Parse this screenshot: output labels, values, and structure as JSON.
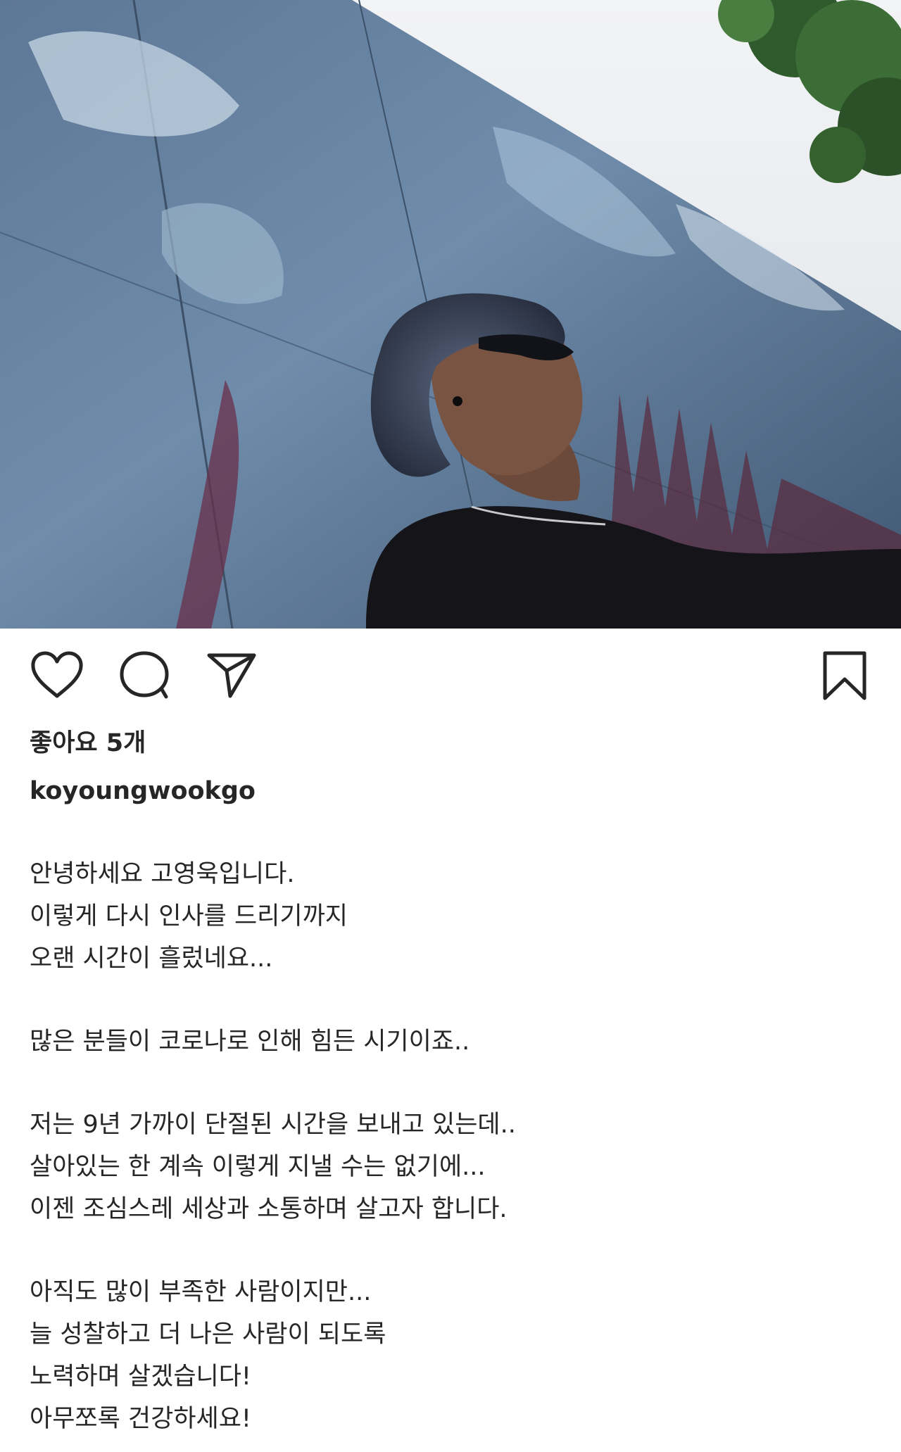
{
  "post": {
    "likes_text": "좋아요 5개",
    "username": "koyoungwookgo",
    "caption": {
      "paragraphs": [
        [
          "안녕하세요 고영욱입니다.",
          "이렇게 다시 인사를 드리기까지",
          "오랜 시간이 흘렀네요..."
        ],
        [
          "많은 분들이 코로나로 인해 힘든 시기이죠.."
        ],
        [
          "저는 9년 가까이 단절된 시간을 보내고 있는데..",
          "살아있는 한 계속 이렇게 지낼 수는 없기에...",
          "이젠 조심스레 세상과 소통하며 살고자 합니다."
        ],
        [
          "아직도 많이 부족한 사람이지만...",
          "늘 성찰하고 더 나은 사람이 되도록",
          "노력하며 살겠습니다!",
          "아무쪼록 건강하세요!"
        ]
      ]
    }
  },
  "actions": {
    "like_icon": "heart-icon",
    "comment_icon": "comment-icon",
    "share_icon": "paper-plane-icon",
    "save_icon": "bookmark-icon"
  },
  "colors": {
    "text": "#262626",
    "icon": "#262626",
    "background": "#ffffff"
  }
}
